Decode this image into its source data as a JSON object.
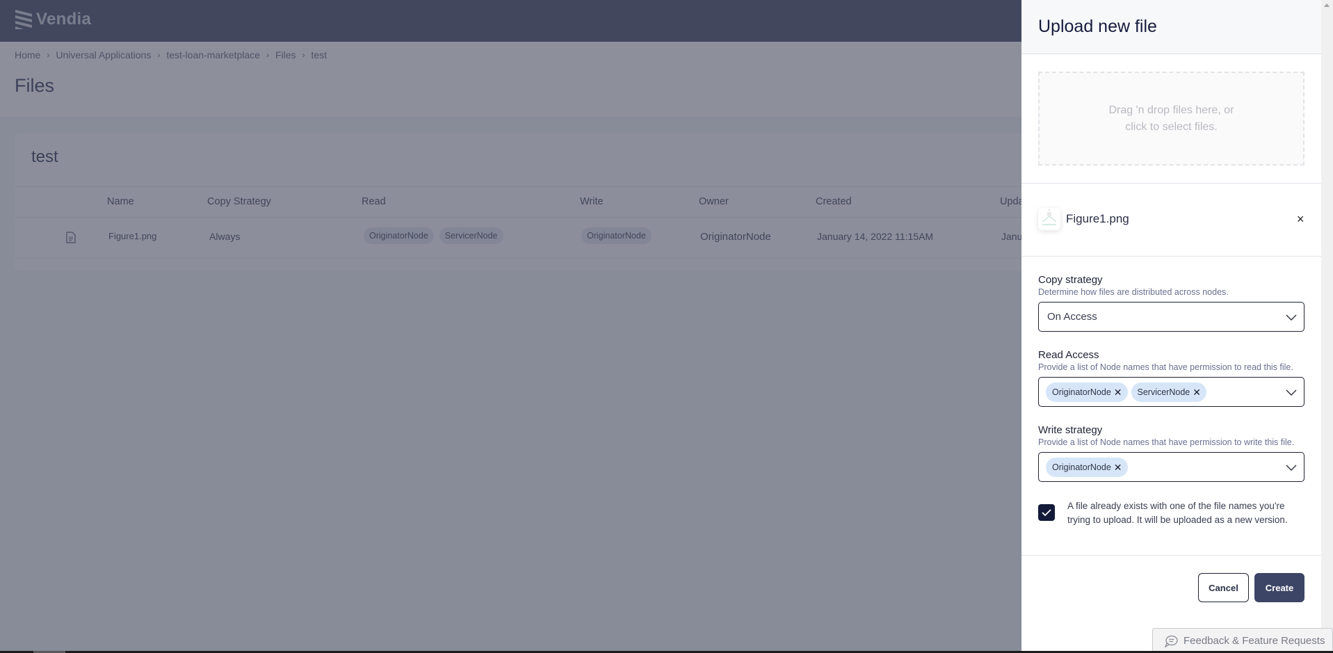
{
  "app": {
    "brand": "Vendia",
    "breadcrumb": [
      "Home",
      "Universal Applications",
      "test-loan-marketplace",
      "Files",
      "test"
    ],
    "breadcrumb_separator": "›",
    "page_title": "Files",
    "card_title": "test",
    "table": {
      "columns": [
        "Name",
        "Copy Strategy",
        "Read",
        "Write",
        "Owner",
        "Created",
        "Upda"
      ],
      "rows": [
        {
          "icon": "file-icon",
          "name": "Figure1.png",
          "copy_strategy": "Always",
          "read": [
            "OriginatorNode",
            "ServicerNode"
          ],
          "write": [
            "OriginatorNode"
          ],
          "owner": "OriginatorNode",
          "created": "January 14, 2022 11:15AM",
          "updated": "Janu"
        }
      ]
    }
  },
  "drawer": {
    "title": "Upload new file",
    "dropzone_line1": "Drag 'n drop files here, or",
    "dropzone_line2": "click to select files.",
    "file": {
      "name": "Figure1.png",
      "remove": "×"
    },
    "copy_strategy": {
      "label": "Copy strategy",
      "help": "Determine how files are distributed across nodes.",
      "value": "On Access"
    },
    "read_access": {
      "label": "Read Access",
      "help": "Provide a list of Node names that have permission to read this file.",
      "values": [
        "OriginatorNode",
        "ServicerNode"
      ]
    },
    "write_strategy": {
      "label": "Write strategy",
      "help": "Provide a list of Node names that have permission to write this file.",
      "values": [
        "OriginatorNode"
      ]
    },
    "overwrite_checkbox": {
      "checked": true,
      "text": "A file already exists with one of the file names you're trying to upload. It will be uploaded as a new version."
    },
    "cancel_label": "Cancel",
    "create_label": "Create",
    "chip_remove": "✕"
  },
  "feedback_label": "Feedback & Feature Requests",
  "colors": {
    "topbar": "#3d4461",
    "primary_button": "#3d4566",
    "checkbox": "#141a3a",
    "chip": "#d6e6f8",
    "overlay": "rgba(70,74,92,0.6)"
  }
}
